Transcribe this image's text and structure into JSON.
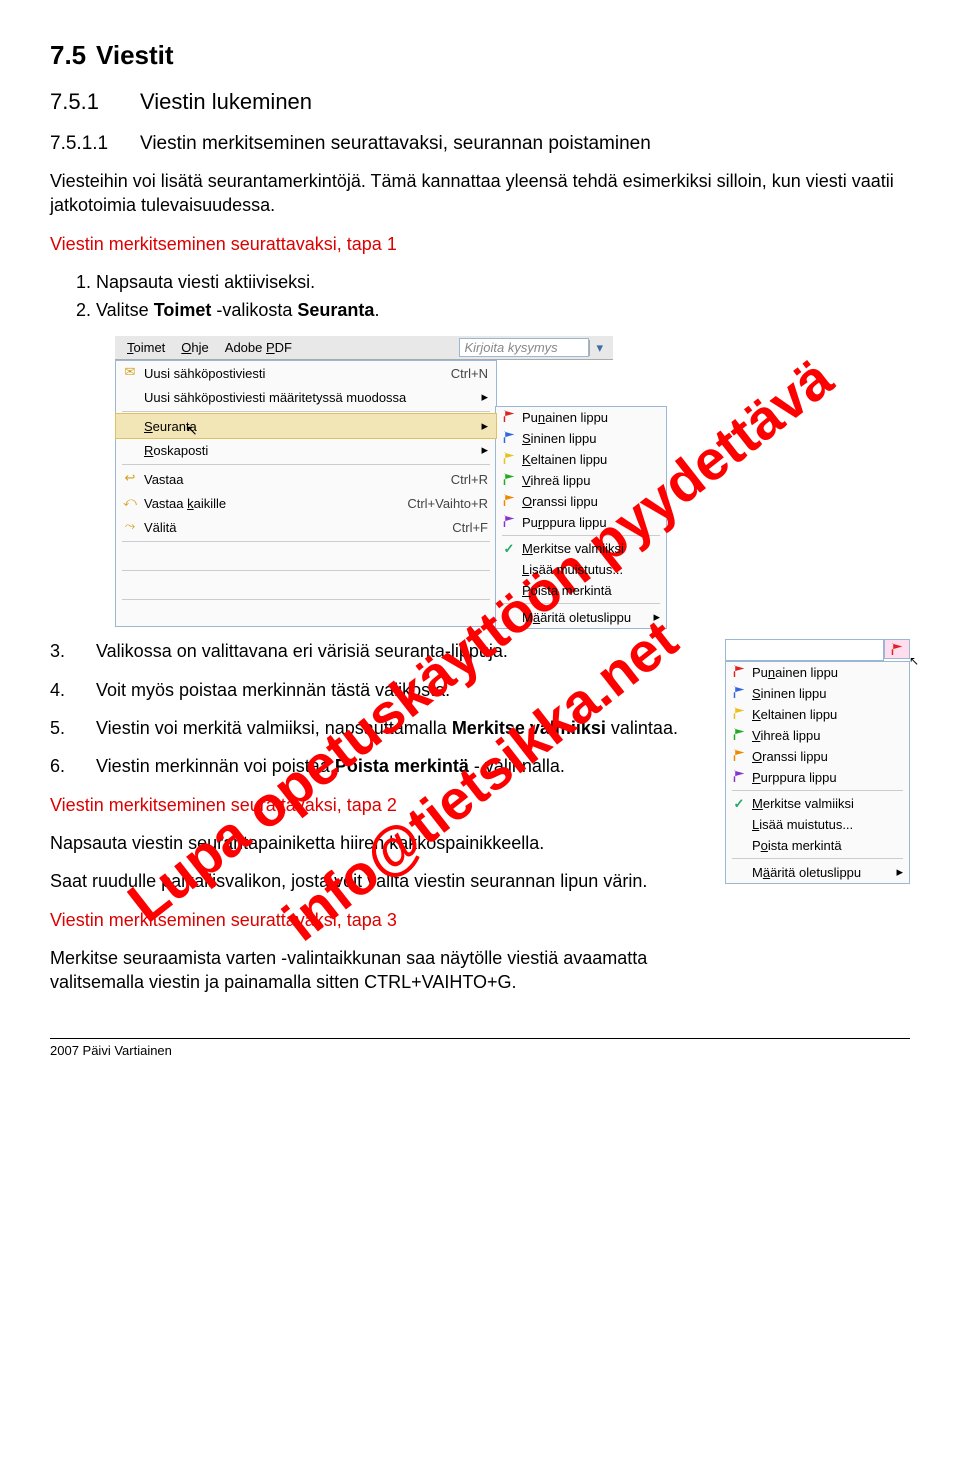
{
  "headings": {
    "h2_num": "7.5",
    "h2": "Viestit",
    "h3_num": "7.5.1",
    "h3": "Viestin lukeminen",
    "h4_num": "7.5.1.1",
    "h4": "Viestin merkitseminen seurattavaksi, seurannan poistaminen"
  },
  "intro_p": "Viesteihin voi lisätä seurantamerkintöjä. Tämä kannattaa yleensä tehdä esimerkiksi silloin, kun viesti vaatii jatkotoimia tulevaisuudessa.",
  "tapa1_title": "Viestin merkitseminen seurattavaksi, tapa 1",
  "tapa1_li1": "Napsauta viesti aktiiviseksi.",
  "tapa1_li2_a": "Valitse ",
  "tapa1_li2_b": "Toimet ",
  "tapa1_li2_c": "-valikosta ",
  "tapa1_li2_d": "Seuranta",
  "tapa1_li2_e": ".",
  "list2": {
    "n3": "3.",
    "t3": "Valikossa on valittavana eri värisiä seuranta-lippuja.",
    "n4": "4.",
    "t4": "Voit myös poistaa merkinnän tästä valikosta.",
    "n5": "5.",
    "t5_a": "Viestin voi merkitä valmiiksi, napsauttamalla ",
    "t5_b": "Merkitse valmiiksi",
    "t5_c": " valintaa.",
    "n6": "6.",
    "t6_a": "Viestin merkinnän voi poistaa ",
    "t6_b": "Poista merkintä",
    "t6_c": " -\nvalinnalla."
  },
  "tapa2_title": "Viestin merkitseminen seurattavaksi, tapa 2",
  "tapa2_p1": "Napsauta viestin seurantapainiketta hiiren kakkospainikkeella.",
  "tapa2_p2": "Saat ruudulle paikallisvalikon, josta voit valita viestin seurannan lipun värin.",
  "tapa3_title": "Viestin merkitseminen seurattavaksi, tapa 3",
  "tapa3_p": "Merkitse seuraamista varten -valintaikkunan saa näytölle viestiä avaamatta valitsemalla viestin ja painamalla sitten CTRL+VAIHTO+G.",
  "footer": "2007 Päivi Vartiainen",
  "scr1": {
    "menubar": {
      "toimet": "Toimet",
      "ohje": "Ohje",
      "adobe": "Adobe PDF",
      "search": "Kirjoita kysymys"
    },
    "items": [
      {
        "icon": "envelope",
        "label": "Uusi sähköpostiviesti",
        "sc": "Ctrl+N"
      },
      {
        "icon": "",
        "label": "Uusi sähköpostiviesti määritetyssä muodossa",
        "sub": true
      }
    ],
    "seuranta": "Seuranta",
    "roskaposti": "Roskaposti",
    "items2": [
      {
        "icon": "envreply",
        "label": "Vastaa",
        "sc": "Ctrl+R"
      },
      {
        "icon": "envall",
        "label": "Vastaa kaikille",
        "sc": "Ctrl+Vaihto+R"
      },
      {
        "icon": "envfwd",
        "label": "Välitä",
        "sc": "Ctrl+F"
      }
    ]
  },
  "flagsub": [
    {
      "c": "fl-red",
      "t": "Punainen lippu"
    },
    {
      "c": "fl-blue",
      "t": "Sininen lippu"
    },
    {
      "c": "fl-yellow",
      "t": "Keltainen lippu"
    },
    {
      "c": "fl-green",
      "t": "Vihreä lippu"
    },
    {
      "c": "fl-orange",
      "t": "Oranssi lippu"
    },
    {
      "c": "fl-purple",
      "t": "Purppura lippu"
    }
  ],
  "flagextra": {
    "valmiiksi": "Merkitse valmiiksi",
    "muistutus": "Lisää muistutus...",
    "poista": "Poista merkintä",
    "oletus": "Määritä oletuslippu"
  },
  "ctx": [
    {
      "c": "fl-red",
      "t": "Punainen lippu"
    },
    {
      "c": "fl-blue",
      "t": "Sininen lippu"
    },
    {
      "c": "fl-yellow",
      "t": "Keltainen lippu"
    },
    {
      "c": "fl-green",
      "t": "Vihreä lippu"
    },
    {
      "c": "fl-orange",
      "t": "Oranssi lippu"
    },
    {
      "c": "fl-purple",
      "t": "Purppura lippu"
    }
  ],
  "wm1": "Lupa opetuskäyttöön pyydettävä",
  "wm2": "info@tietsikka.net"
}
